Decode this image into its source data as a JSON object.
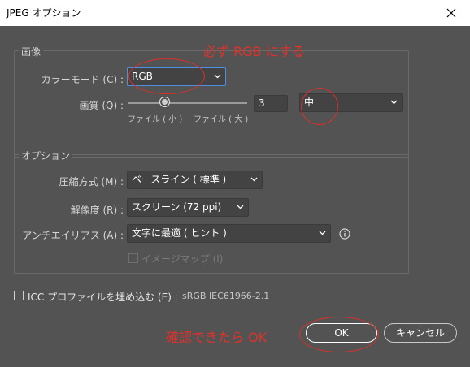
{
  "window": {
    "title": "JPEG オプション"
  },
  "image_group": {
    "legend": "画像",
    "color_mode_label": "カラーモード (C) :",
    "color_mode_value": "RGB",
    "quality_label": "画質 (Q) :",
    "quality_value": "3",
    "quality_preset": "中",
    "slider_min_label": "ファイル ( 小 )",
    "slider_max_label": "ファイル ( 大 )"
  },
  "options_group": {
    "legend": "オプション",
    "compression_label": "圧縮方式 (M) :",
    "compression_value": "ベースライン ( 標準 )",
    "resolution_label": "解像度 (R) :",
    "resolution_value": "スクリーン (72 ppi)",
    "antialias_label": "アンチエイリアス (A) :",
    "antialias_value": "文字に最適 ( ヒント )",
    "imagemap_label": "イメージマップ (I)"
  },
  "icc": {
    "label": "ICC プロファイルを埋め込む (E) :",
    "profile": "sRGB IEC61966-2.1"
  },
  "buttons": {
    "ok": "OK",
    "cancel": "キャンセル"
  },
  "annotations": {
    "rgb_note": "必ず RGB にする",
    "ok_note": "確認できたら OK",
    "color": "#e0322a"
  }
}
